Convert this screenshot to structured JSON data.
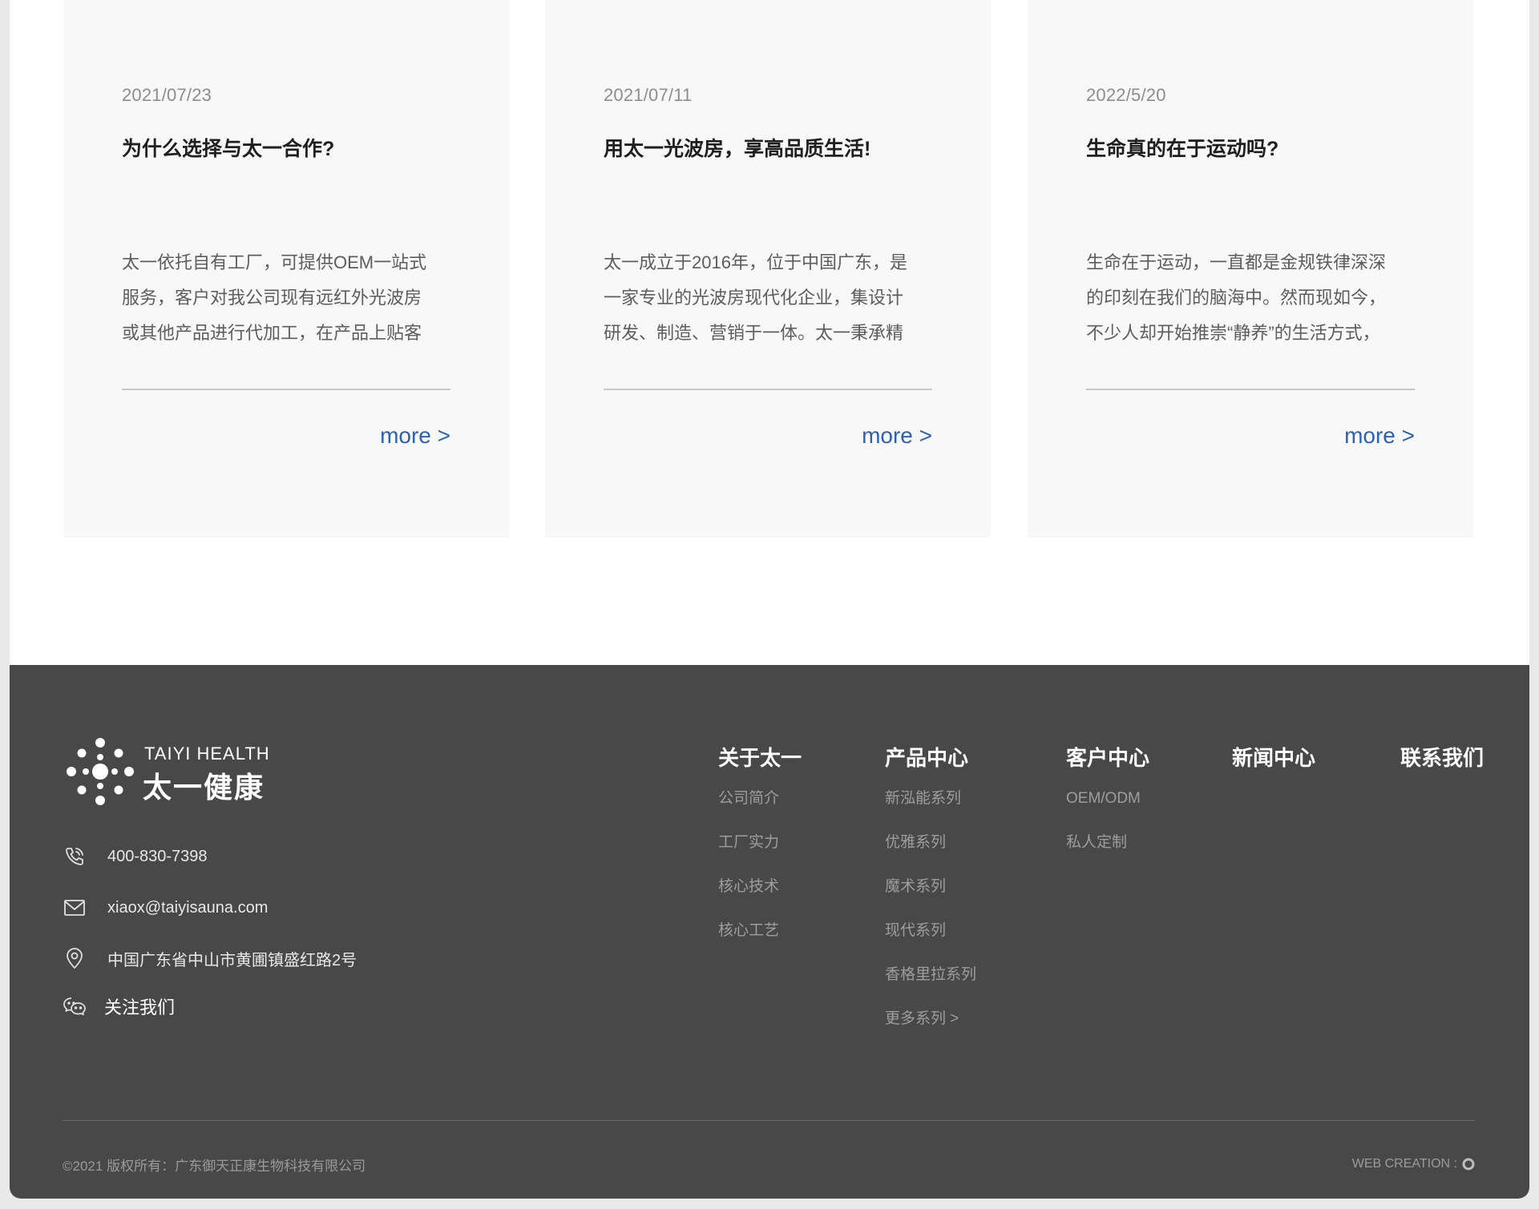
{
  "news": {
    "cards": [
      {
        "date": "2021/07/23",
        "title": "为什么选择与太一合作?",
        "excerpt_lines": [
          "太一依托自有工厂，可提供OEM一站式",
          "服务，客户对我公司现有远红外光波房",
          "或其他产品进行代加工，在产品上贴客"
        ],
        "more": "more >"
      },
      {
        "date": "2021/07/11",
        "title": "用太一光波房，享高品质生活!",
        "excerpt_lines": [
          "太一成立于2016年，位于中国广东，是",
          "一家专业的光波房现代化企业，集设计",
          "研发、制造、营销于一体。太一秉承精"
        ],
        "more": "more >"
      },
      {
        "date": "2022/5/20",
        "title": "生命真的在于运动吗?",
        "excerpt_lines": [
          "生命在于运动，一直都是金规铁律深深",
          "的印刻在我们的脑海中。然而现如今，",
          "不少人却开始推崇“静养”的生活方式，"
        ],
        "more": "more >"
      }
    ]
  },
  "footer": {
    "logo": {
      "en": "TAIYI HEALTH",
      "cn": "太一健康"
    },
    "contact": {
      "phone": "400-830-7398",
      "email": "xiaox@taiyisauna.com",
      "address": "中国广东省中山市黄圃镇盛红路2号",
      "follow": "关注我们"
    },
    "icons": {
      "phone": "phone-icon",
      "email": "mail-icon",
      "address": "location-pin-icon",
      "follow": "wechat-icon"
    },
    "nav": [
      {
        "head": "关于太一",
        "items": [
          "公司简介",
          "工厂实力",
          "核心技术",
          "核心工艺"
        ]
      },
      {
        "head": "产品中心",
        "items": [
          "新泓能系列",
          "优雅系列",
          "魔术系列",
          "现代系列",
          "香格里拉系列",
          "更多系列 >"
        ]
      },
      {
        "head": "客户中心",
        "items": [
          "OEM/ODM",
          "私人定制"
        ]
      },
      {
        "head": "新闻中心",
        "items": []
      },
      {
        "head": "联系我们",
        "items": []
      }
    ],
    "copyright": "©2021 版权所有：广东御天正康生物科技有限公司",
    "web_creation": "WEB CREATION :"
  },
  "colors": {
    "card_bg": "#f8f8f8",
    "footer_bg": "#484848",
    "link_blue": "#2a62b8"
  }
}
